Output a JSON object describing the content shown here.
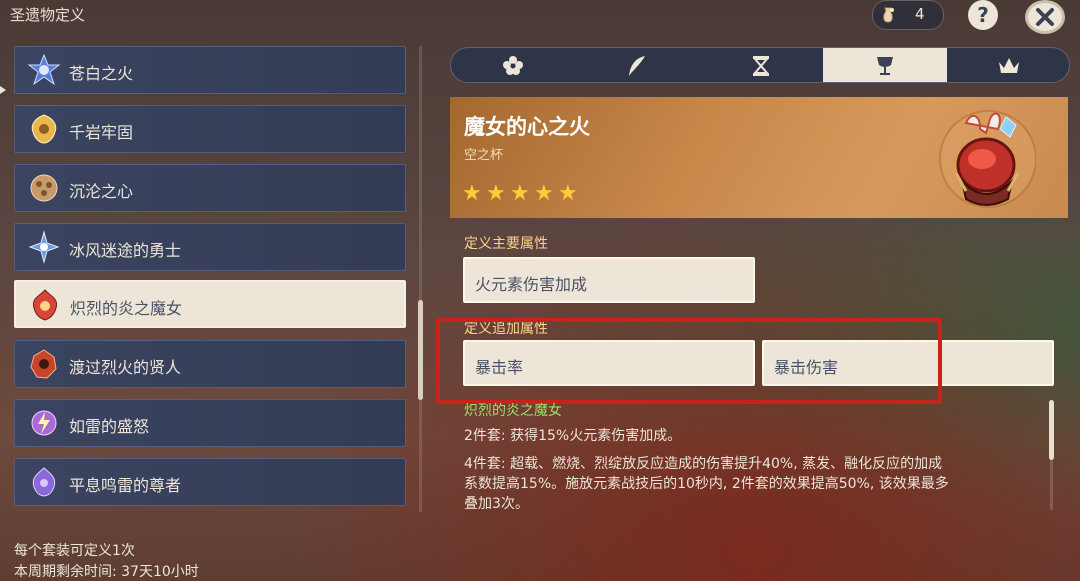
{
  "header": {
    "title": "圣遗物定义",
    "currency_count": "4",
    "help_label": "?",
    "currency_icon": "dust-vial-icon",
    "close_icon": "close-icon"
  },
  "set_list": {
    "items": [
      {
        "label": "苍白之火",
        "icon": "pale-flame-icon",
        "color": "#5a7fd8"
      },
      {
        "label": "千岩牢固",
        "icon": "tenacity-icon",
        "color": "#e8b84a"
      },
      {
        "label": "沉沦之心",
        "icon": "heart-of-depth-icon",
        "color": "#c99a6a"
      },
      {
        "label": "冰风迷途的勇士",
        "icon": "blizzard-strayer-icon",
        "color": "#6a9be8"
      },
      {
        "label": "炽烈的炎之魔女",
        "icon": "crimson-witch-icon",
        "color": "#d8453a",
        "selected": true
      },
      {
        "label": "渡过烈火的贤人",
        "icon": "lavawalker-icon",
        "color": "#c8452a"
      },
      {
        "label": "如雷的盛怒",
        "icon": "thundering-fury-icon",
        "color": "#a86ad8"
      },
      {
        "label": "平息鸣雷的尊者",
        "icon": "thundersoother-icon",
        "color": "#8a6ad8"
      }
    ]
  },
  "footer": {
    "note1": "每个套装可定义1次",
    "note2": "本周期剩余时间: 37天10小时"
  },
  "tabs": [
    {
      "icon": "flower-icon"
    },
    {
      "icon": "plume-icon"
    },
    {
      "icon": "sands-icon"
    },
    {
      "icon": "goblet-icon",
      "active": true
    },
    {
      "icon": "circlet-icon"
    }
  ],
  "artifact": {
    "name": "魔女的心之火",
    "slot": "空之杯",
    "stars": 5
  },
  "main_stat": {
    "title": "定义主要属性",
    "value": "火元素伤害加成"
  },
  "sub_stats": {
    "title": "定义追加属性",
    "values": [
      "暴击率",
      "暴击伤害"
    ]
  },
  "set_bonus": {
    "name": "炽烈的炎之魔女",
    "two_piece": "2件套: 获得15%火元素伤害加成。",
    "four_piece_line1": "4件套: 超载、燃烧、烈绽放反应造成的伤害提升40%, 蒸发、融化反应的加成",
    "four_piece_line2": "系数提高15%。施放元素战技后的10秒内, 2件套的效果提高50%, 该效果最多",
    "four_piece_line3": "叠加3次。"
  },
  "colors": {
    "highlight_box": "#c8231b",
    "star": "#ffcc32",
    "set_name": "#9ae06a",
    "section_title": "#ffd38a"
  }
}
